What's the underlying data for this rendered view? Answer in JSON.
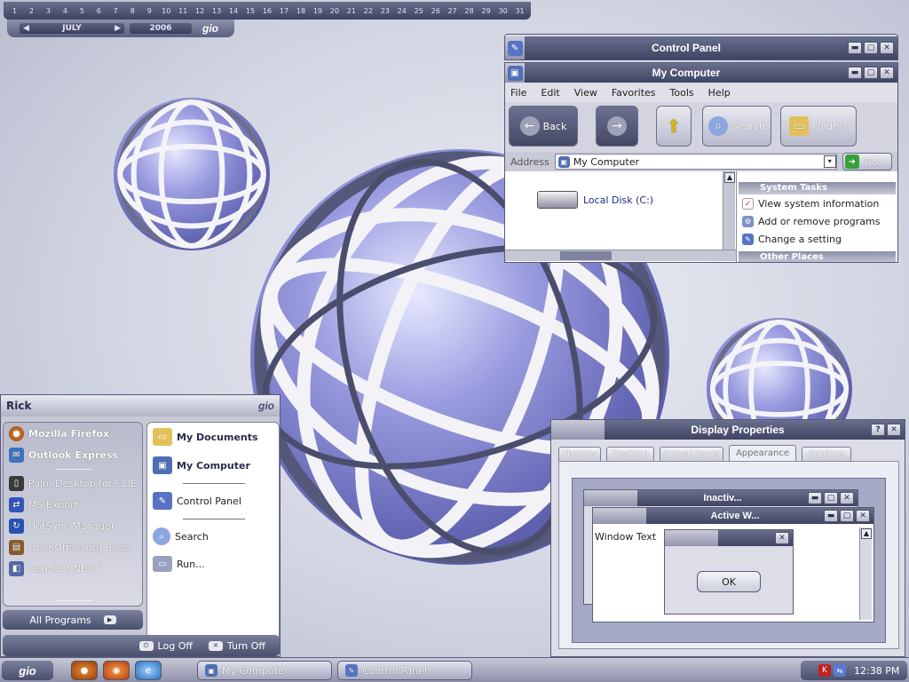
{
  "calendar": {
    "days": [
      "1",
      "2",
      "3",
      "4",
      "5",
      "6",
      "7",
      "8",
      "9",
      "10",
      "11",
      "12",
      "13",
      "14",
      "15",
      "16",
      "17",
      "18",
      "19",
      "20",
      "21",
      "22",
      "23",
      "24",
      "25",
      "26",
      "27",
      "28",
      "29",
      "30",
      "31"
    ],
    "month": "JULY",
    "year": "2006",
    "logo": "gio"
  },
  "control_panel": {
    "title": "Control Panel"
  },
  "my_computer": {
    "title": "My Computer",
    "menu": [
      "File",
      "Edit",
      "View",
      "Favorites",
      "Tools",
      "Help"
    ],
    "toolbar": {
      "back": "Back",
      "search": "Search",
      "folders": "Folders"
    },
    "address_label": "Address",
    "address_value": "My Computer",
    "go_label": "Go",
    "drive_label": "Local Disk (C:)",
    "system_tasks_title": "System Tasks",
    "tasks": [
      "View system information",
      "Add or remove programs",
      "Change a setting"
    ],
    "other_places_title": "Other Places"
  },
  "start_menu": {
    "user": "Rick",
    "logo": "gio",
    "pinned": [
      "Mozilla Firefox",
      "Outlook Express"
    ],
    "recent": [
      "Palm Desktop for CLIE",
      "MS Export",
      "HotSync Manager",
      "OpenOffice.org Base",
      "Lexi-CONNECT"
    ],
    "right": [
      "My Documents",
      "My Computer",
      "Control Panel",
      "Search",
      "Run..."
    ],
    "all_programs": "All Programs",
    "log_off": "Log Off",
    "turn_off": "Turn Off"
  },
  "display_properties": {
    "title": "Display Properties",
    "tabs": [
      "Themes",
      "Desktop",
      "Screen Saver",
      "Appearance",
      "Settings"
    ],
    "inactive_title": "Inactiv...",
    "active_title": "Active W...",
    "window_text": "Window Text",
    "ok_label": "OK"
  },
  "taskbar": {
    "start_logo": "gio",
    "items": [
      "My Computer",
      "Control Panel"
    ],
    "clock": "12:38 PM"
  },
  "colors": {
    "accent": "#4a4f6e",
    "title_text": "#ffffff",
    "link": "#1e2a8a"
  }
}
